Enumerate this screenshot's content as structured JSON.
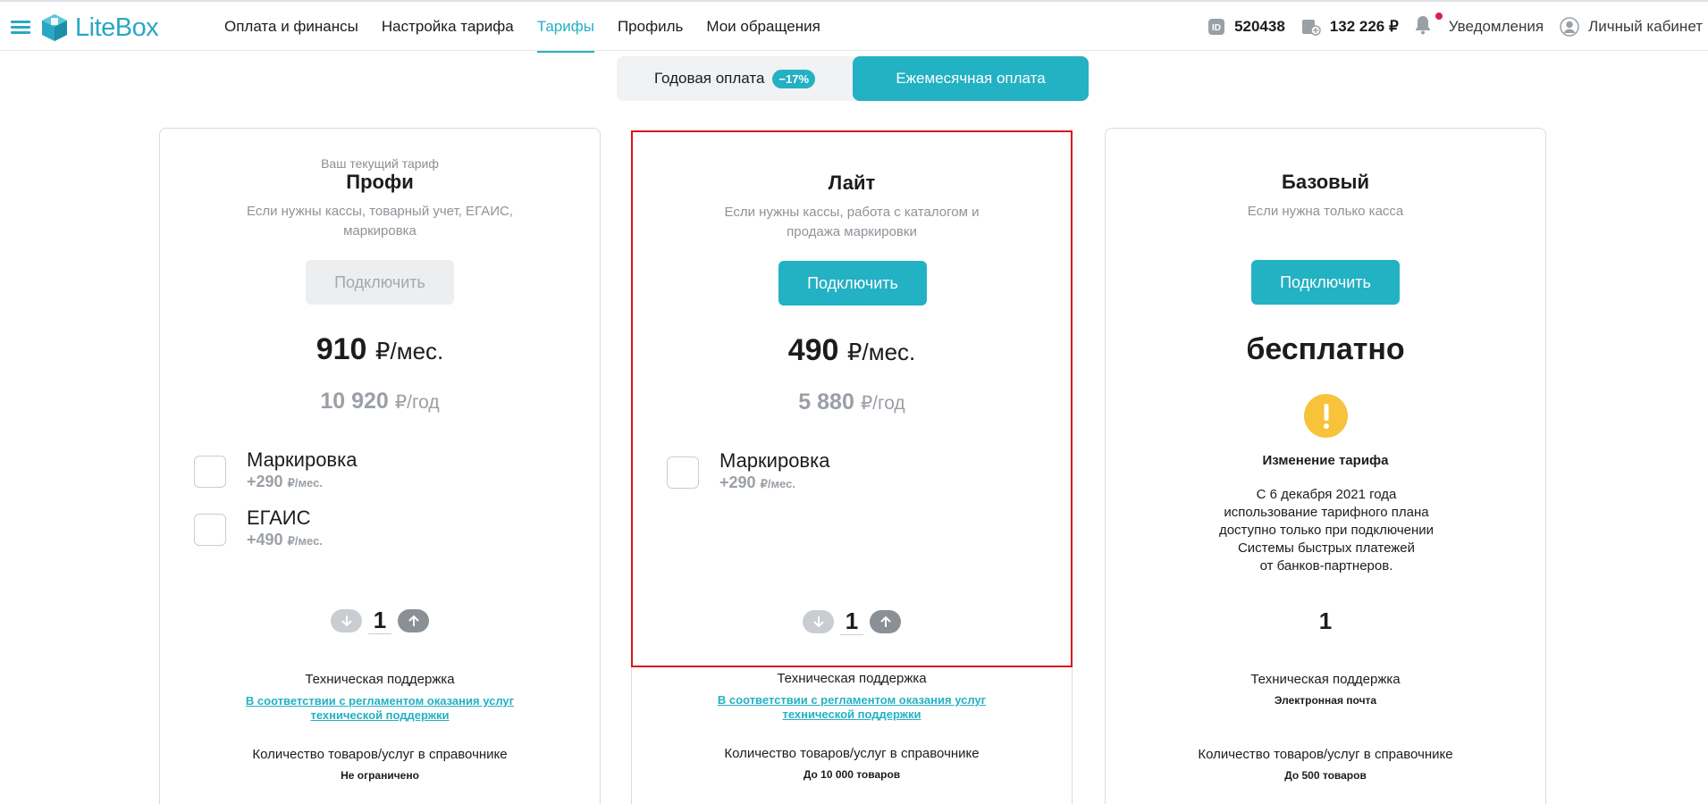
{
  "header": {
    "logo_text": "LiteBox",
    "nav": [
      "Оплата и финансы",
      "Настройка тарифа",
      "Тарифы",
      "Профиль",
      "Мои обращения"
    ],
    "active_nav": "Тарифы",
    "account_id": "520438",
    "balance": "132 226 ₽",
    "notifications_label": "Уведомления",
    "cabinet_label": "Личный кабинет",
    "accent_color": "#23b1c4",
    "notification_dot_color": "#d6214a"
  },
  "billing_toggle": {
    "yearly_label": "Годовая оплата",
    "yearly_badge": "−17%",
    "monthly_label": "Ежемесячная оплата",
    "selected": "monthly"
  },
  "plans": {
    "profi": {
      "current_label": "Ваш текущий тариф",
      "name": "Профи",
      "description": "Если нужны кассы, товарный учет, ЕГАИС, маркировка",
      "button_label": "Подключить",
      "button_state": "disabled",
      "price": "910",
      "price_unit": "₽/мес.",
      "yearly_price": "10 920",
      "yearly_unit": "₽/год",
      "addons": [
        {
          "name": "Маркировка",
          "price": "+290",
          "unit": "₽/мес."
        },
        {
          "name": "ЕГАИС",
          "price": "+490",
          "unit": "₽/мес."
        }
      ],
      "quantity": "1",
      "support_title": "Техническая поддержка",
      "support_value": "В соответствии с регламентом оказания услуг технической поддержки",
      "catalog_title": "Количество товаров/услуг в справочнике",
      "catalog_value": "Не ограничено"
    },
    "lite": {
      "name": "Лайт",
      "description": "Если нужны кассы, работа с каталогом и продажа маркировки",
      "button_label": "Подключить",
      "price": "490",
      "price_unit": "₽/мес.",
      "yearly_price": "5 880",
      "yearly_unit": "₽/год",
      "addons": [
        {
          "name": "Маркировка",
          "price": "+290",
          "unit": "₽/мес."
        }
      ],
      "quantity": "1",
      "support_title": "Техническая поддержка",
      "support_value": "В соответствии с регламентом оказания услуг технической поддержки",
      "catalog_title": "Количество товаров/услуг в справочнике",
      "catalog_value": "До 10 000 товаров"
    },
    "basic": {
      "name": "Базовый",
      "description": "Если нужна только касса",
      "button_label": "Подключить",
      "price": "бесплатно",
      "warning_title": "Изменение тарифа",
      "warning_lines": [
        "С 6 декабря 2021 года",
        "использование тарифного плана",
        "доступно только при подключении",
        "Системы быстрых платежей",
        "от банков-партнеров."
      ],
      "quantity": "1",
      "support_title": "Техническая поддержка",
      "support_value": "Электронная почта",
      "catalog_title": "Количество товаров/услуг в справочнике",
      "catalog_value": "До 500 товаров"
    }
  }
}
